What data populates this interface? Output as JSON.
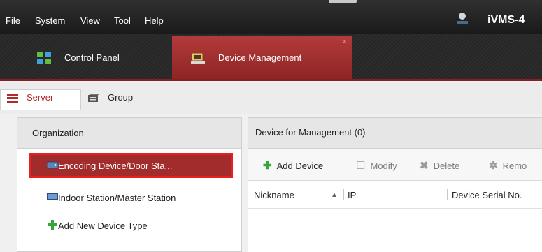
{
  "menu": {
    "items": [
      "File",
      "System",
      "View",
      "Tool",
      "Help"
    ],
    "app_title": "iVMS-4"
  },
  "tabs": [
    {
      "label": "Control Panel",
      "icon": "grid-icon"
    },
    {
      "label": "Device Management",
      "icon": "device-manager-icon",
      "active": true
    }
  ],
  "subbar": {
    "server_label": "Server",
    "group_label": "Group"
  },
  "organization": {
    "header": "Organization",
    "items": [
      {
        "label": "Encoding Device/Door Sta...",
        "icon": "encoder-device-icon",
        "selected": true
      },
      {
        "label": "Indoor Station/Master Station",
        "icon": "monitor-icon"
      },
      {
        "label": "Add New Device Type",
        "icon": "plus-icon"
      }
    ]
  },
  "devices": {
    "header": "Device for Management (0)",
    "toolbar": {
      "add": "Add Device",
      "modify": "Modify",
      "delete": "Delete",
      "remove": "Remo"
    },
    "columns": {
      "nickname": "Nickname",
      "ip": "IP",
      "serial": "Device Serial No."
    }
  },
  "colors": {
    "accent_red": "#a22b2b",
    "highlight_border": "#e52121",
    "add_green": "#3aa33a"
  }
}
